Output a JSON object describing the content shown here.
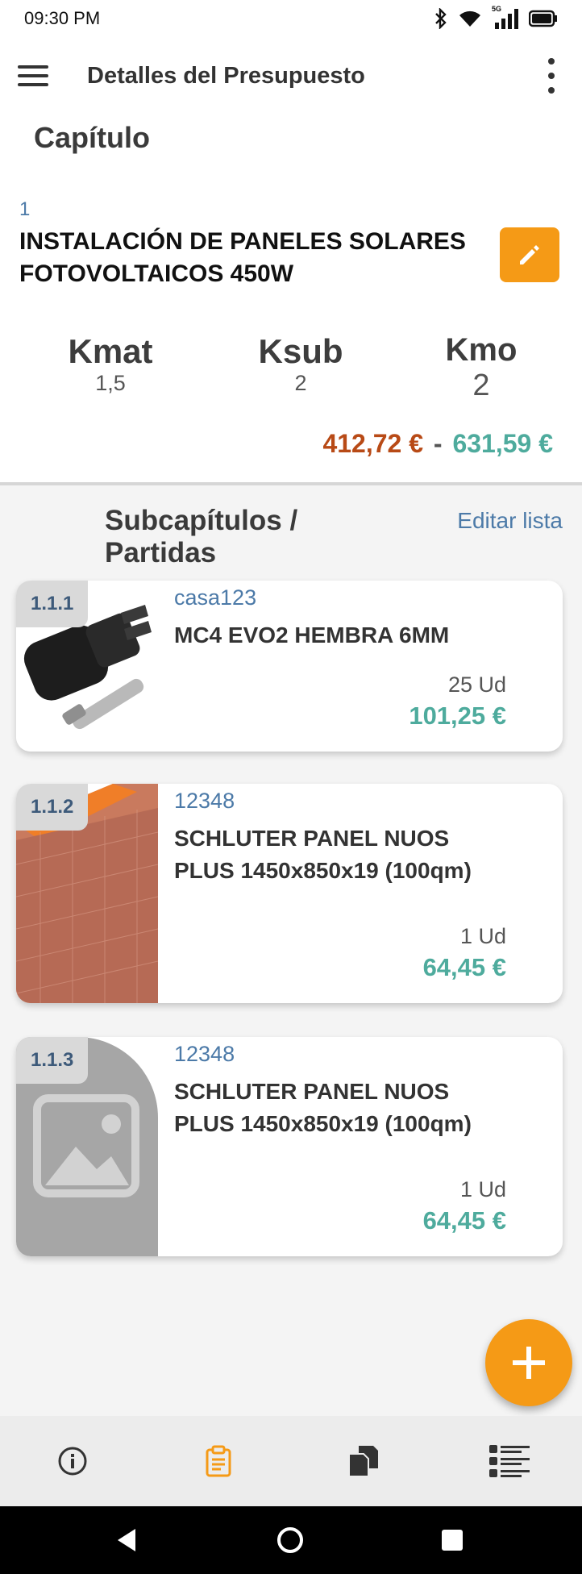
{
  "status_bar": {
    "time": "09:30 PM",
    "network_label": "5G"
  },
  "app_bar": {
    "title": "Detalles del Presupuesto"
  },
  "section": {
    "title": "Capítulo"
  },
  "chapter": {
    "number": "1",
    "name": "INSTALACIÓN DE PANELES SOLARES FOTOVOLTAICOS 450W"
  },
  "coefficients": [
    {
      "label": "Kmat",
      "value": "1,5"
    },
    {
      "label": "Ksub",
      "value": "2"
    },
    {
      "label": "Kmo",
      "value": "2"
    }
  ],
  "price_range": {
    "min": "412,72 €",
    "separator": "-",
    "max": "631,59 €"
  },
  "list": {
    "title": "Subcapítulos / Partidas",
    "edit_link": "Editar lista",
    "items": [
      {
        "badge": "1.1.1",
        "code": "casa123",
        "name": "MC4 EVO2 HEMBRA 6MM",
        "quantity": "25 Ud",
        "price": "101,25 €",
        "image": "connector-photo"
      },
      {
        "badge": "1.1.2",
        "code": "12348",
        "name": "SCHLUTER PANEL NUOS PLUS 1450x850x19 (100qm)",
        "quantity": "1 Ud",
        "price": "64,45 €",
        "image": "panel-roll-photo"
      },
      {
        "badge": "1.1.3",
        "code": "12348",
        "name": "SCHLUTER PANEL NUOS PLUS 1450x850x19 (100qm)",
        "quantity": "1 Ud",
        "price": "64,45 €",
        "image": "image-placeholder-icon"
      }
    ]
  },
  "bottom_nav": [
    "info-icon",
    "clipboard-icon",
    "copy-icon",
    "list-icon"
  ],
  "colors": {
    "accent": "#f59a16",
    "price_min": "#b84a16",
    "price_max": "#4eab9d",
    "link": "#4c7aa8",
    "nav_active": "#f59a16"
  }
}
